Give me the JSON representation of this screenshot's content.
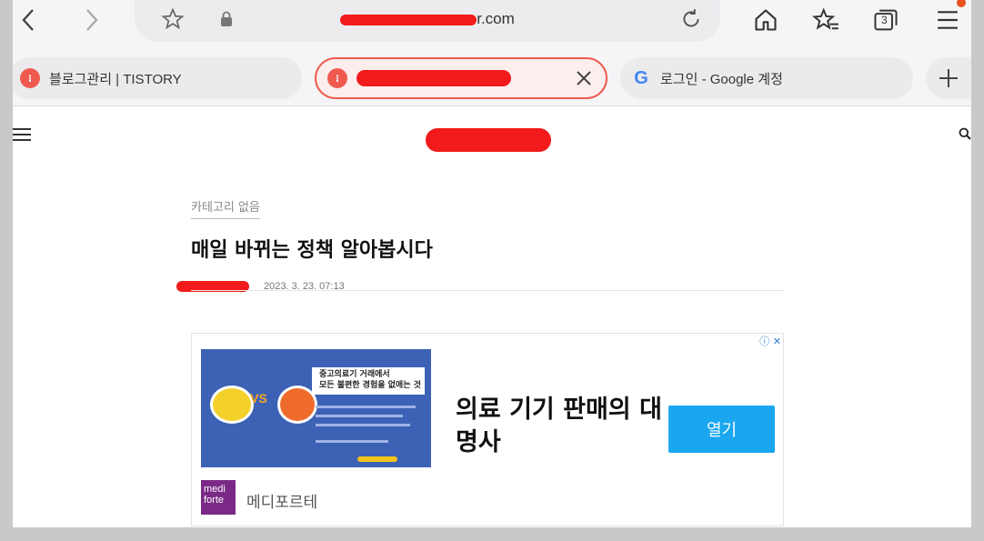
{
  "browser": {
    "url": "r.com",
    "tab_count": "3"
  },
  "tabs": [
    {
      "label": "블로그관리 | TISTORY",
      "favicon": "tistory-favicon"
    },
    {
      "label": "",
      "favicon": "tistory-favicon",
      "active": true
    },
    {
      "label": "로그인 - Google 계정",
      "favicon": "google-favicon"
    }
  ],
  "post": {
    "category": "카테고리 없음",
    "title": "매일 바뀌는 정책 알아봅시다",
    "date": "2023. 3. 23. 07:13"
  },
  "ad": {
    "image_caption_line1": "중고의료기 거래에서",
    "image_caption_line2": "모든 불편한 경험을 없애는 것",
    "headline": "의료 기기 판매의 대명사",
    "open_label": "열기",
    "brand_logo": "medi forte",
    "brand_name": "메디포르테",
    "vs": "VS"
  },
  "colors": {
    "accent": "#ef5a4f",
    "button": "#1aa7f0",
    "redaction": "#f21a1a"
  }
}
